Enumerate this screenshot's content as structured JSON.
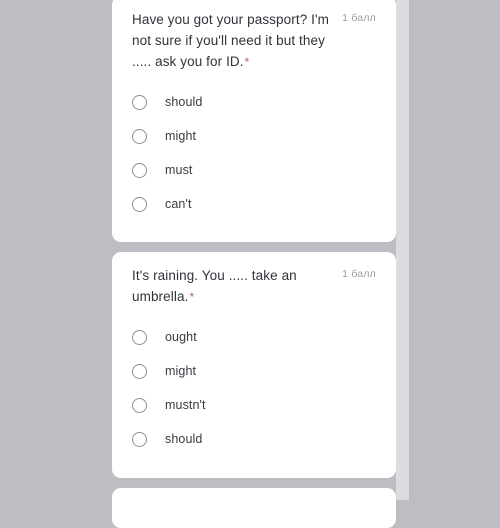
{
  "page": {
    "background_color": "#bdbdc4",
    "card_background_color": "#ffffff",
    "required_marker": "*",
    "required_marker_color": "#b46464",
    "scrollbar_color": "#dcdce0"
  },
  "questions": [
    {
      "text": "Have you got your passport? I'm not sure if you'll need it but they ..... ask you for ID.",
      "required_marker": "*",
      "points": "1 балл",
      "options": [
        {
          "label": "should"
        },
        {
          "label": "might"
        },
        {
          "label": "must"
        },
        {
          "label": "can't"
        }
      ]
    },
    {
      "text": "It's raining. You ..... take an umbrella.",
      "required_marker": "*",
      "points": "1 балл",
      "options": [
        {
          "label": "ought"
        },
        {
          "label": "might"
        },
        {
          "label": "mustn't"
        },
        {
          "label": "should"
        }
      ]
    },
    {
      "text": "",
      "required_marker": "",
      "points": "",
      "options": []
    }
  ]
}
